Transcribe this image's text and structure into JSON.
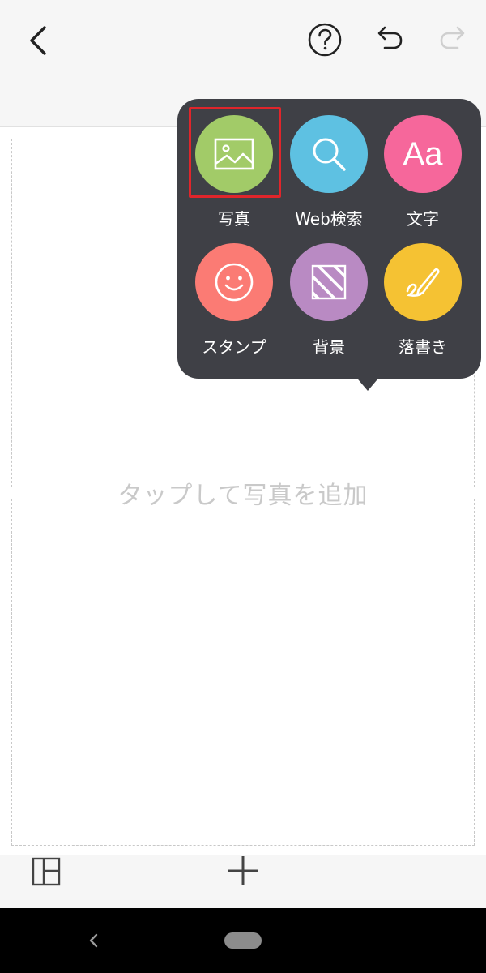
{
  "toolbar": {
    "back_icon": "chevron-left-icon",
    "help_icon": "question-circle-icon",
    "undo_icon": "undo-icon",
    "redo_icon": "redo-icon"
  },
  "canvas": {
    "placeholder": "タップして写真を追加"
  },
  "popup": {
    "items": [
      {
        "label": "写真",
        "icon": "image-icon",
        "color": "#a2cb68"
      },
      {
        "label": "Web検索",
        "icon": "search-icon",
        "color": "#5ec1e2"
      },
      {
        "label": "文字",
        "icon": "text-aa-icon",
        "glyph": "Aa",
        "color": "#f6679b"
      },
      {
        "label": "スタンプ",
        "icon": "smiley-icon",
        "color": "#fb7b74"
      },
      {
        "label": "背景",
        "icon": "pattern-icon",
        "color": "#b98ac3"
      },
      {
        "label": "落書き",
        "icon": "pencil-icon",
        "color": "#f5c233"
      }
    ]
  },
  "bottom": {
    "layout_icon": "layout-grid-icon",
    "add_icon": "plus-icon"
  },
  "system_nav": {
    "back_icon": "nav-back-icon",
    "home_icon": "nav-home-pill"
  }
}
